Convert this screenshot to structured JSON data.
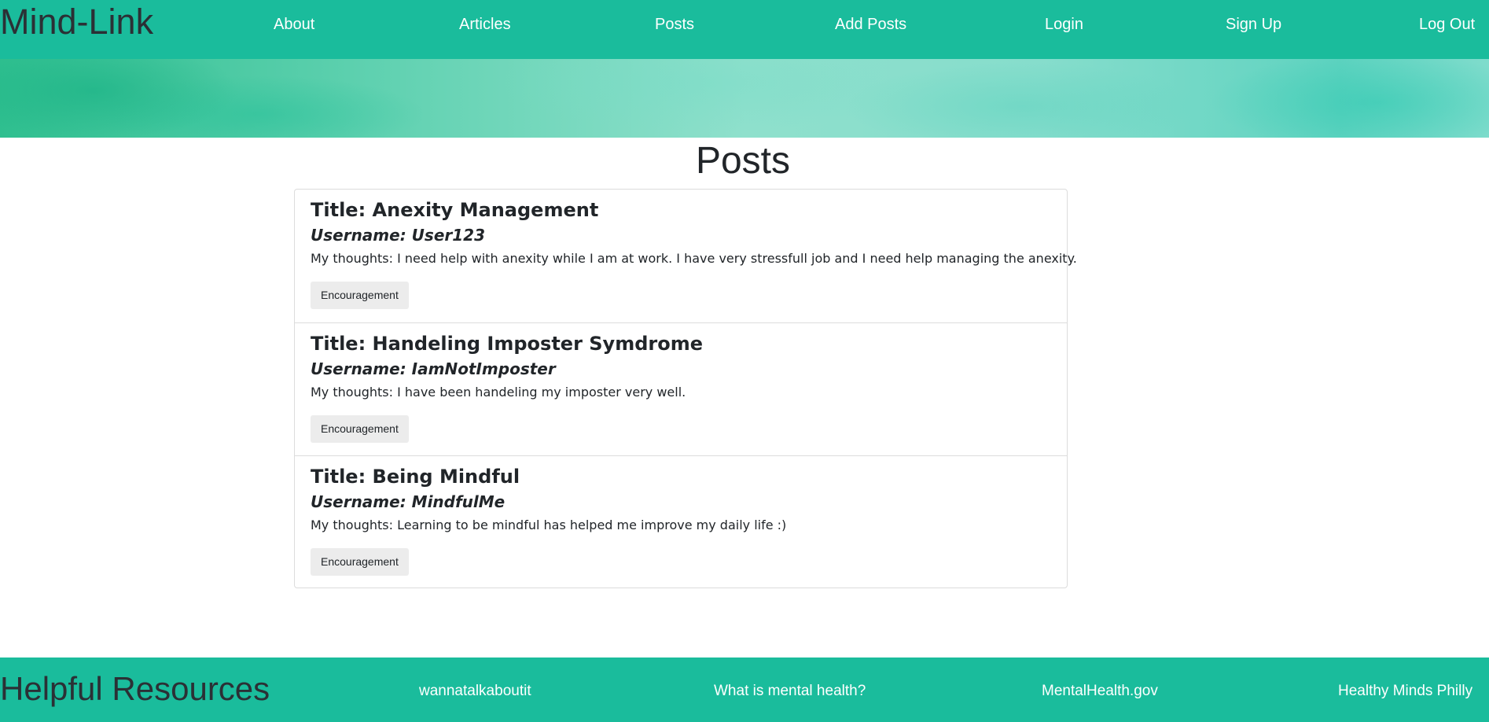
{
  "header": {
    "brand": "Mind-Link",
    "nav": [
      "About",
      "Articles",
      "Posts",
      "Add Posts",
      "Login",
      "Sign Up",
      "Log Out"
    ]
  },
  "main": {
    "title": "Posts",
    "posts": [
      {
        "title": "Title: Anexity Management",
        "username": "Username: User123",
        "thoughts": "My thoughts: I need help with anexity while I am at work. I have very stressfull job and I need help managing the anexity.",
        "button": "Encouragement"
      },
      {
        "title": "Title: Handeling Imposter Symdrome",
        "username": "Username: IamNotImposter",
        "thoughts": "My thoughts: I have been handeling my imposter very well.",
        "button": "Encouragement"
      },
      {
        "title": "Title: Being Mindful",
        "username": "Username: MindfulMe",
        "thoughts": "My thoughts: Learning to be mindful has helped me improve my daily life :)",
        "button": "Encouragement"
      }
    ]
  },
  "footer": {
    "title": "Helpful Resources",
    "links": [
      "wannatalkaboutit",
      "What is mental health?",
      "MentalHealth.gov",
      "Healthy Minds Philly"
    ]
  },
  "colors": {
    "accent": "#1abc9c",
    "brand_text": "#2b3035",
    "button_bg": "#ececec"
  }
}
